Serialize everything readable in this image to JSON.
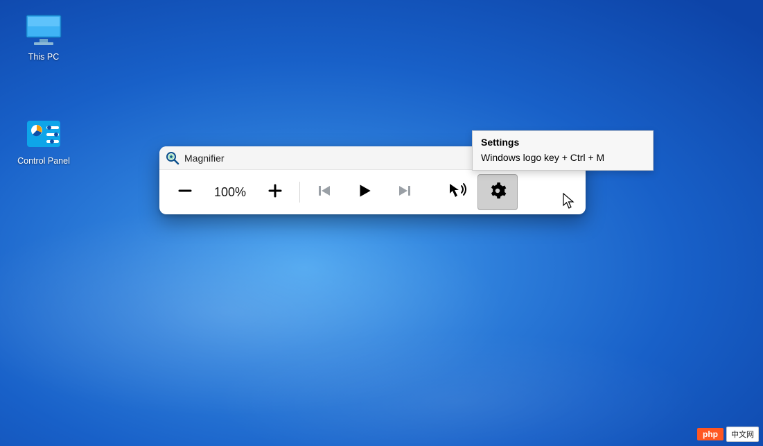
{
  "desktop": {
    "icons": [
      {
        "label": "This PC"
      },
      {
        "label": "Control Panel"
      }
    ]
  },
  "magnifier": {
    "title": "Magnifier",
    "zoom_level": "100%",
    "buttons": {
      "zoom_out": "zoom-out",
      "zoom_in": "zoom-in",
      "prev": "previous",
      "play": "play",
      "next": "next",
      "read_aloud": "read-aloud-cursor",
      "settings": "settings"
    },
    "minimize": "—"
  },
  "tooltip": {
    "title": "Settings",
    "subtitle": "Windows logo key + Ctrl + M"
  },
  "watermark": {
    "php": "php",
    "cn": "中文网"
  }
}
